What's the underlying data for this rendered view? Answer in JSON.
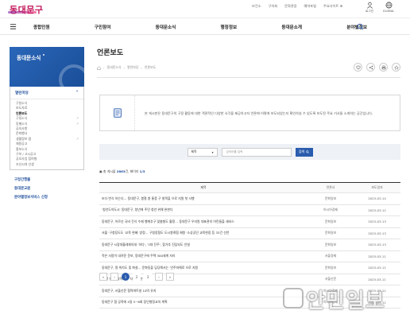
{
  "header": {
    "logo": "동대문구",
    "util_links": [
      "보건소",
      "구의회",
      "문화관광",
      "예약포털",
      "주요사이트 ⊕"
    ],
    "login_label": "로그인",
    "global_label": "GLOBAL"
  },
  "gnb": {
    "items": [
      "종합민원",
      "구민참여",
      "동대문소식",
      "행정정보",
      "동대문소개",
      "분야별정보"
    ]
  },
  "sidebar": {
    "title": "동대문소식",
    "section_open": "열린마당",
    "sub_items": [
      {
        "label": "구청소식",
        "active": false,
        "external": false
      },
      {
        "label": "보도자료",
        "active": false,
        "external": false
      },
      {
        "label": "언론보도",
        "active": true,
        "external": false
      },
      {
        "label": "구정소식",
        "active": false,
        "external": true
      },
      {
        "label": "동별소식",
        "active": false,
        "external": true
      },
      {
        "label": "공지사항",
        "active": false,
        "external": false
      },
      {
        "label": "문화행사",
        "active": false,
        "external": false
      },
      {
        "label": "생활정보 앱",
        "active": false,
        "external": true
      },
      {
        "label": "채용공고",
        "active": false,
        "external": false
      },
      {
        "label": "홍보소식",
        "active": false,
        "external": false
      },
      {
        "label": "구보 / 고시공고",
        "active": false,
        "external": false
      },
      {
        "label": "공모사업 참여형",
        "active": false,
        "external": false
      },
      {
        "label": "조선시대 선생",
        "active": false,
        "external": false
      }
    ],
    "bottom_items": [
      "구정간행물",
      "동대문교원",
      "분야별정보서비스 신청"
    ]
  },
  "main": {
    "title": "언론보도",
    "breadcrumb": [
      "동대문소식",
      "열린마당",
      "언론보도"
    ],
    "tool_icons": [
      "heart-icon",
      "share-icon",
      "print-icon",
      "star-icon"
    ],
    "notice": "본 게시판은 동대문구의 구정 활동에 대한 객관적인 다양한 사각을 제공하고자 언론에 어떻게 보도되었는지 확인하실 수 있도록 보도된 주요 기사들 소개하는 공간입니다.",
    "search": {
      "select_label": "제목",
      "placeholder": "검색어를 입력",
      "button": "검색"
    },
    "count": {
      "prefix": "총 게시물",
      "total": "2863",
      "pages_label": "페이지",
      "page_info": "1/3"
    },
    "table": {
      "headers": [
        "제목",
        "언론사",
        "보도일자"
      ],
      "rows": [
        {
          "title": "또다 번식 하는다… 동대문구, 봄철 흰 통증 구 발목을 으로 지원 첫 사행",
          "press": "문화일보",
          "date": "2025-03-14"
        },
        {
          "title": "'청년도약도시' 동대문구, 청년에 주민 청년 위해 완판다",
          "press": "아시아경제",
          "date": "2025-03-12"
        },
        {
          "title": "동대문구, 어르신 국비 건식 수제 행계추구 맞춤형도 활용… 동대문구 우리원 대표관리 어린들을 세비스",
          "press": "문화일보",
          "date": "2025-03-13"
        },
        {
          "title": "서울 '구청장도도 '교육 현혜' 방정… 구청장협도 도시봉례협 제원 '소상공인 교육현장 등 32건 선언",
          "press": "문화일보",
          "date": "2025-03-13"
        },
        {
          "title": "동대문구 시장대흘레회의내 '하다', '3대 진주', 참가추 진담되도 안설",
          "press": "문화일보",
          "date": "2025-03-13"
        },
        {
          "title": "적은 사람이 내려준 운보, 동대문구에 주택 300세계 자리",
          "press": "서울경제",
          "date": "2025-03-11"
        },
        {
          "title": "동대문구, 명 위치도 및 화설… 문화동을 담당해서는 '안주마해로 으로 지원",
          "press": "문화일보",
          "date": "2025-03-11"
        },
        {
          "title": "'한학 벌링' 활력화색' 자치 지원'",
          "press": "서울신문",
          "date": "2025-03-11"
        },
        {
          "title": "동대문구, 서울신문 협력파트설 10억 유지",
          "press": "아시아경제",
          "date": "2025-03-11"
        },
        {
          "title": "동대문구 협 공족에 4일 5~6회 장인형정교의 계획",
          "press": "아시아경제",
          "date": "2025-03-11"
        }
      ]
    },
    "pager": {
      "first": "«",
      "prev": "‹",
      "pages": [
        "1",
        "2",
        "3"
      ],
      "next": "›",
      "last": "»",
      "current": "1"
    }
  },
  "watermark": "안민일보"
}
